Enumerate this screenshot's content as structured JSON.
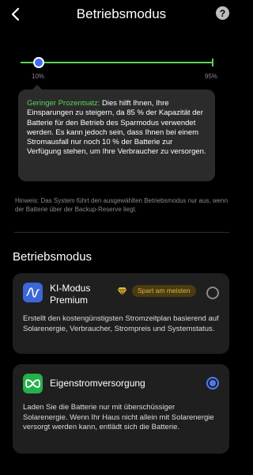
{
  "header": {
    "title": "Betriebsmodus",
    "help_symbol": "?"
  },
  "slider": {
    "min_label": "10%",
    "max_label": "95%",
    "value_percent": 10
  },
  "tooltip": {
    "highlight": "Geringer Prozentsatz:",
    "text": " Dies hilft Ihnen, Ihre Einsparungen zu steigern, da 85 % der Kapazität der Batterie für den Betrieb des Sparmodus verwendet werden. Es kann jedoch sein, dass Ihnen bei einem Stromausfall nur noch 10 % der Batterie zur Verfügung stehen, um Ihre Verbraucher zu versorgen."
  },
  "hint": "Hinweis: Das System führt den ausgewählten Betriebsmodus nur aus, wenn der Batterie über der Backup-Reserve liegt.",
  "section_title": "Betriebsmodus",
  "modes": [
    {
      "title": "KI-Modus Premium",
      "badge": "Spart am meisten",
      "description": "Erstellt den kostengünstigsten Stromzeitplan basierend auf Solarenergie, Verbraucher, Strompreis und Systemstatus.",
      "selected": false,
      "icon": "ai-wave-icon"
    },
    {
      "title": "Eigenstromversorgung",
      "description": "Laden Sie die Batterie nur mit überschüssiger Solarenergie. Wenn Ihr Haus nicht allein mit Solarenergie versorgt werden kann, entlädt sich die Batterie.",
      "selected": true,
      "icon": "infinity-icon"
    }
  ],
  "colors": {
    "background": "#000000",
    "card": "#1f1f1f",
    "accent_blue": "#3b6df5",
    "accent_green": "#5bd35a",
    "badge_text": "#d9b34a"
  }
}
